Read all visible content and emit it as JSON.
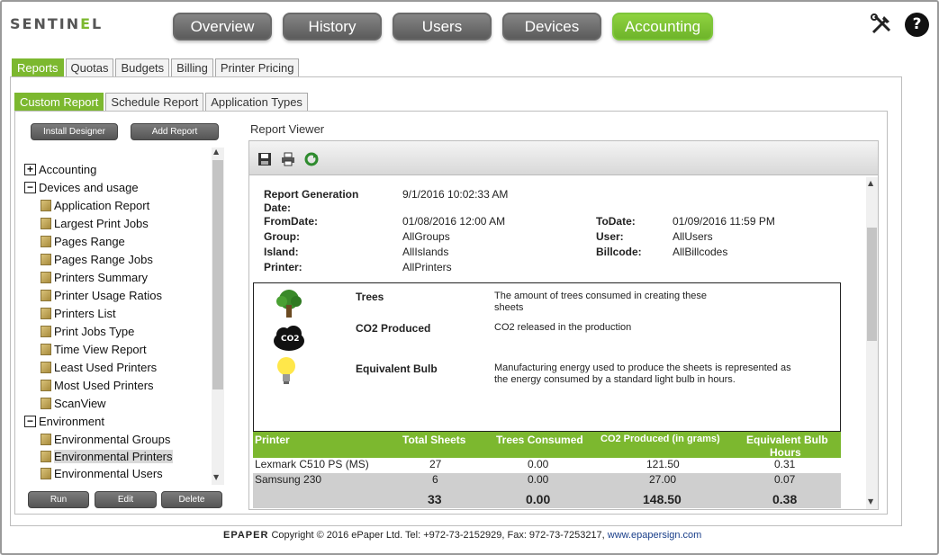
{
  "brand": {
    "logo_a": "SENTIN",
    "logo_e": "E",
    "logo_b": "L"
  },
  "topnav": {
    "items": [
      "Overview",
      "History",
      "Users",
      "Devices",
      "Accounting"
    ],
    "active": "Accounting"
  },
  "header_icons": {
    "tools": "tools-icon",
    "help": "?"
  },
  "tabs_level1": {
    "items": [
      "Reports",
      "Quotas",
      "Budgets",
      "Billing",
      "Printer Pricing"
    ],
    "active": "Reports"
  },
  "tabs_level2": {
    "items": [
      "Custom Report",
      "Schedule Report",
      "Application Types"
    ],
    "active": "Custom Report"
  },
  "left_buttons": {
    "install_designer": "Install Designer",
    "add_report": "Add Report",
    "run": "Run",
    "edit": "Edit",
    "delete": "Delete"
  },
  "tree": {
    "accounting": "Accounting",
    "devices_and_usage": "Devices and usage",
    "devices_children": [
      "Application Report",
      "Largest Print Jobs",
      "Pages Range",
      "Pages Range Jobs",
      "Printers Summary",
      "Printer Usage Ratios",
      "Printers List",
      "Print Jobs Type",
      "Time View Report",
      "Least Used Printers",
      "Most Used Printers",
      "ScanView"
    ],
    "environment": "Environment",
    "environment_children": [
      "Environmental Groups",
      "Environmental Printers",
      "Environmental Users"
    ],
    "selected": "Environmental Printers"
  },
  "report_viewer": {
    "title": "Report Viewer",
    "toolbar": [
      "save-icon",
      "print-icon",
      "refresh-icon"
    ],
    "meta": {
      "gen_label_1": "Report Generation",
      "gen_label_2": "Date:",
      "gen_value": "9/1/2016 10:02:33 AM",
      "from_label": "FromDate:",
      "from_value": "01/08/2016 12:00 AM",
      "to_label": "ToDate:",
      "to_value": "01/09/2016 11:59 PM",
      "group_label": "Group:",
      "group_value": "AllGroups",
      "user_label": "User:",
      "user_value": "AllUsers",
      "island_label": "Island:",
      "island_value": "AllIslands",
      "billcode_label": "Billcode:",
      "billcode_value": "AllBillcodes",
      "printer_label": "Printer:",
      "printer_value": "AllPrinters"
    },
    "legend": {
      "trees_title": "Trees",
      "trees_desc_1": "The amount of trees consumed in creating these",
      "trees_desc_2": "sheets",
      "co2_title": "CO2 Produced",
      "co2_icon_text": "CO2",
      "co2_desc": "CO2  released in the  production",
      "bulb_title": "Equivalent Bulb",
      "bulb_desc_1": "Manufacturing energy used to produce the sheets is represented as",
      "bulb_desc_2": "the energy consumed by a standard light bulb in hours."
    },
    "table": {
      "headers": {
        "printer": "Printer",
        "total_sheets": "Total Sheets",
        "trees": "Trees Consumed",
        "co2": "CO2 Produced (in grams)",
        "bulb_1": "Equivalent Bulb",
        "bulb_2": "Hours"
      },
      "rows": [
        {
          "printer": "Lexmark C510 PS (MS)",
          "total_sheets": "27",
          "trees": "0.00",
          "co2": "121.50",
          "bulb": "0.31"
        },
        {
          "printer": "Samsung 230",
          "total_sheets": "6",
          "trees": "0.00",
          "co2": "27.00",
          "bulb": "0.07"
        }
      ],
      "totals": {
        "total_sheets": "33",
        "trees": "0.00",
        "co2": "148.50",
        "bulb": "0.38"
      }
    }
  },
  "footer": {
    "brand": "EPAPER",
    "text": " Copyright © 2016 ePaper Ltd. Tel: +972-73-2152929, Fax: 972-73-7253217, ",
    "link": "www.epapersign.com"
  },
  "colors": {
    "accent": "#7cb82f",
    "nav_gray": "#6a6a6a"
  }
}
